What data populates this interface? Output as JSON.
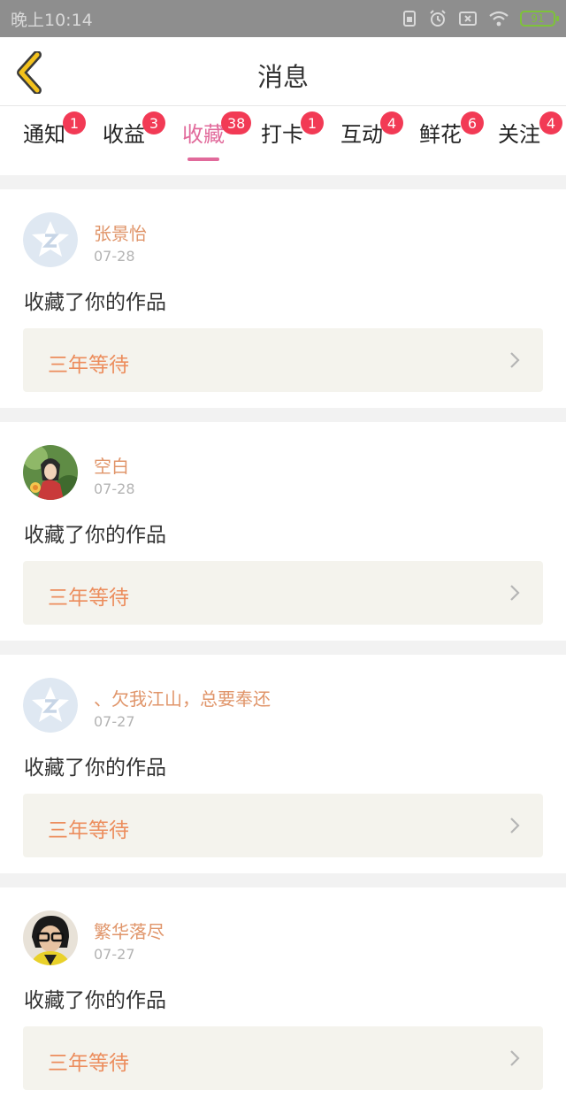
{
  "status_bar": {
    "time": "晚上10:14",
    "battery": "91",
    "icons": [
      "sim-card-icon",
      "alarm-icon",
      "no-sim-icon",
      "wifi-icon",
      "battery-icon"
    ],
    "battery_color": "#7ec23a"
  },
  "header": {
    "title": "消息",
    "back_icon": "chevron-left-icon",
    "back_color": "#f4c21c"
  },
  "tabs": [
    {
      "label": "通知",
      "badge": "1",
      "active": false
    },
    {
      "label": "收益",
      "badge": "3",
      "active": false
    },
    {
      "label": "收藏",
      "badge": "38",
      "active": true
    },
    {
      "label": "打卡",
      "badge": "1",
      "active": false
    },
    {
      "label": "互动",
      "badge": "4",
      "active": false
    },
    {
      "label": "鲜花",
      "badge": "6",
      "active": false
    },
    {
      "label": "关注",
      "badge": "4",
      "active": false
    }
  ],
  "colors": {
    "active_tab": "#e16a9b",
    "badge": "#f23a55",
    "username": "#e0956a",
    "work_title": "#ec8d5d",
    "work_box_bg": "#f4f3ed"
  },
  "feed": [
    {
      "username": "张景怡",
      "date": "07-28",
      "action": "收藏了你的作品",
      "work_title": "三年等待",
      "avatar": "default-qzone-avatar"
    },
    {
      "username": "空白",
      "date": "07-28",
      "action": "收藏了你的作品",
      "work_title": "三年等待",
      "avatar": "photo-avatar-green"
    },
    {
      "username": "、欠我江山，总要奉还",
      "date": "07-27",
      "action": "收藏了你的作品",
      "work_title": "三年等待",
      "avatar": "default-qzone-avatar"
    },
    {
      "username": "繁华落尽",
      "date": "07-27",
      "action": "收藏了你的作品",
      "work_title": "三年等待",
      "avatar": "photo-avatar-glasses"
    }
  ]
}
